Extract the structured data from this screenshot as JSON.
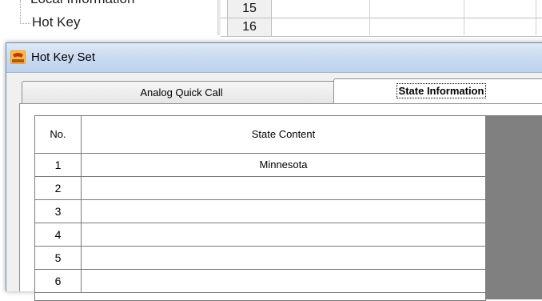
{
  "background": {
    "tree": {
      "clipped_item": "Local Information",
      "hotkey_item": "Hot Key"
    },
    "grid_rows": [
      "15",
      "16"
    ]
  },
  "dialog": {
    "title": "Hot Key Set",
    "tabs": [
      {
        "label": "Analog Quick Call",
        "selected": false
      },
      {
        "label": "State Information",
        "selected": true
      }
    ],
    "table": {
      "headers": {
        "no": "No.",
        "content": "State Content"
      },
      "rows": [
        {
          "no": "1",
          "content": "Minnesota"
        },
        {
          "no": "2",
          "content": ""
        },
        {
          "no": "3",
          "content": ""
        },
        {
          "no": "4",
          "content": ""
        },
        {
          "no": "5",
          "content": ""
        },
        {
          "no": "6",
          "content": ""
        }
      ]
    }
  },
  "colors": {
    "titlebar": "#c7daf0",
    "client_bg": "#f0f0f0",
    "grey_area": "#808080"
  }
}
